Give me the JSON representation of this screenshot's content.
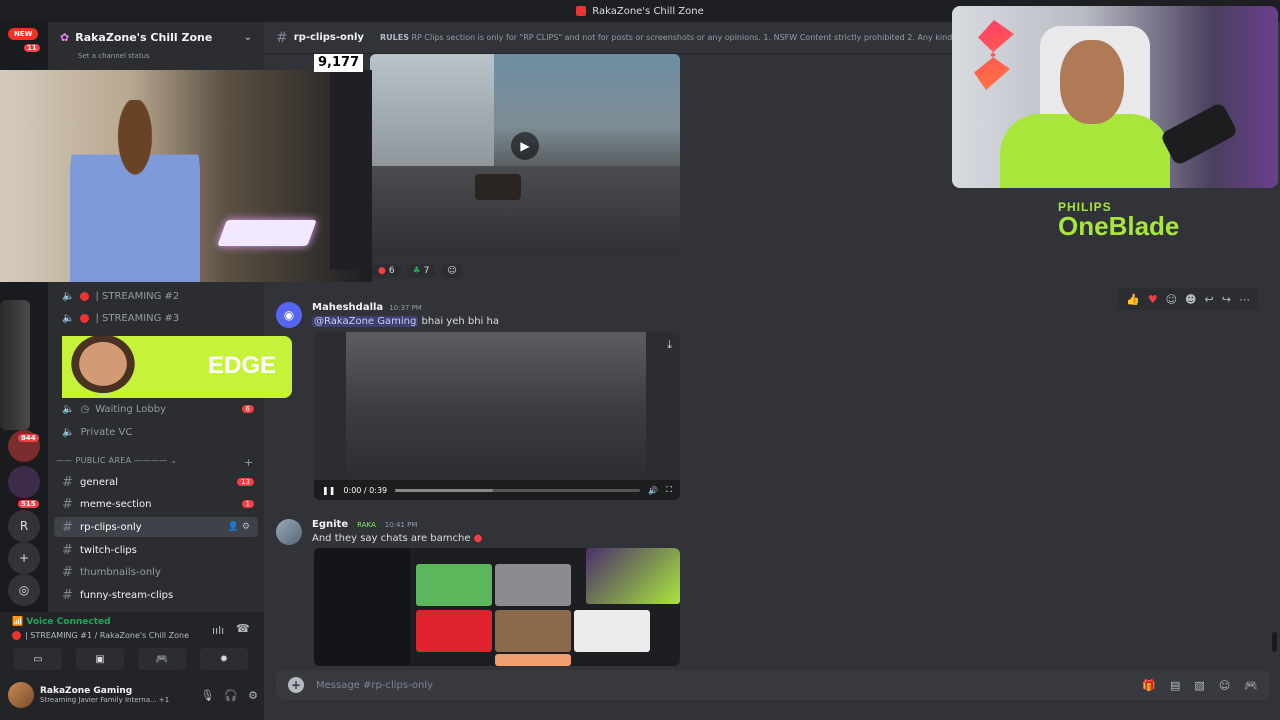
{
  "window": {
    "title": "RakaZone's Chill Zone"
  },
  "overlay": {
    "viewers": "9,177",
    "new_badge": "NEW",
    "edge_text": "EDGE",
    "brand_line1": "PHILIPS",
    "brand_line2": "OneBlade"
  },
  "servers": [
    {
      "label": "",
      "badge": "11"
    },
    {
      "label": "",
      "badge": "844"
    },
    {
      "label": "",
      "badge": ""
    },
    {
      "label": "",
      "badge": "515"
    },
    {
      "label": "R",
      "badge": ""
    },
    {
      "label": "+",
      "badge": ""
    },
    {
      "label": "",
      "badge": ""
    }
  ],
  "sidebar": {
    "server_name": "RakaZone's Chill Zone",
    "status": "Set a channel status",
    "voice_channels": [
      {
        "label": "| STREAMING #2"
      },
      {
        "label": "| STREAMING #3"
      },
      {
        "label": "Waiting Lobby",
        "count": "6"
      },
      {
        "label": "Private VC"
      }
    ],
    "category": "PUBLIC AREA",
    "channels": [
      {
        "label": "general",
        "count": "13"
      },
      {
        "label": "meme-section",
        "count": "1"
      },
      {
        "label": "rp-clips-only"
      },
      {
        "label": "twitch-clips"
      },
      {
        "label": "thumbnails-only"
      },
      {
        "label": "funny-stream-clips"
      }
    ]
  },
  "voice": {
    "title": "Voice Connected",
    "subtitle": "| STREAMING #1 / RakaZone's Chill Zone"
  },
  "user": {
    "name": "RakaZone Gaming",
    "activity": "Streaming Javier Family Interna...",
    "extra": "+1"
  },
  "channel": {
    "name": "rp-clips-only",
    "topic_label": "RULES",
    "topic": "RP Clips section is only for \"RP CLIPS\" and not for posts or screenshots or any opinions. 1. NSFW Content strictly prohibited 2. Any kind of"
  },
  "reactions": [
    {
      "emoji": "",
      "count": "6"
    },
    {
      "emoji": "",
      "count": "7"
    }
  ],
  "messages": [
    {
      "author": "Maheshdalla",
      "time": "10:37 PM",
      "mention": "@RakaZone Gaming",
      "text": "bhai yeh bhi ha",
      "video_time": "0:00 / 0:39",
      "video_progress": 0.4
    },
    {
      "author": "Egnite",
      "tag": "RAKA",
      "time": "10:41 PM",
      "text": "And they say chats are bamche"
    }
  ],
  "composer": {
    "placeholder": "Message #rp-clips-only"
  },
  "colors": {
    "accent": "#5865f2",
    "green": "#23a55a",
    "red": "#f23f43",
    "brand_green": "#a8e63c"
  }
}
